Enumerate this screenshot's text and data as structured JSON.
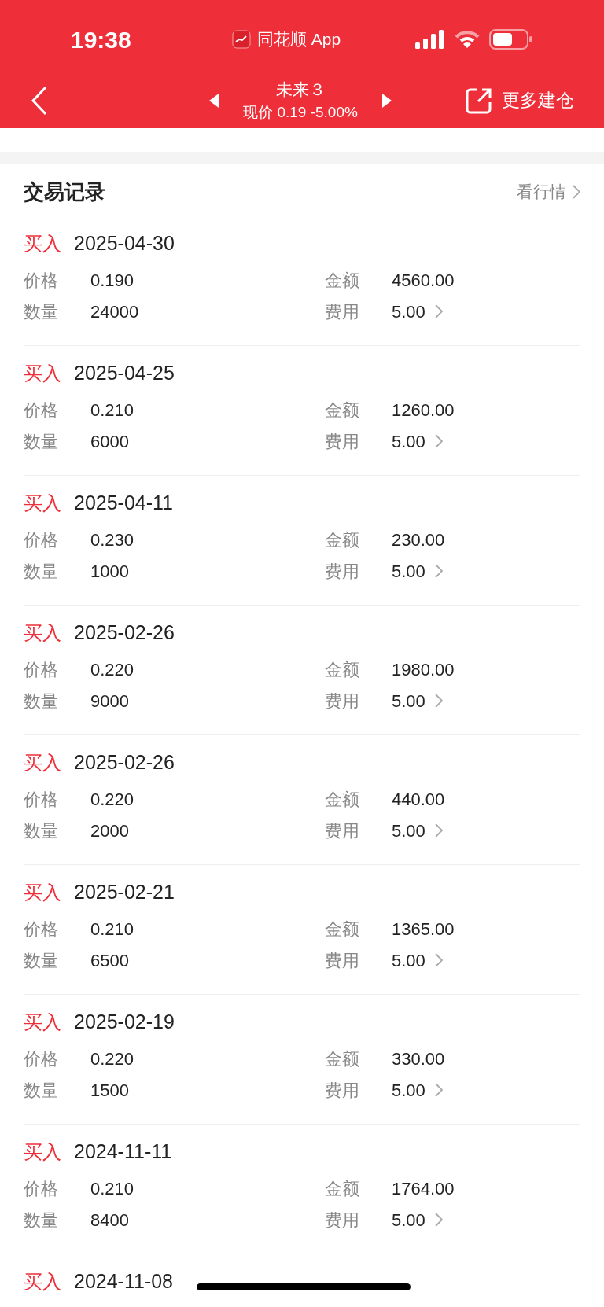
{
  "status_bar": {
    "time": "19:38",
    "app": "同花顺 App"
  },
  "header": {
    "title": "未来３",
    "subtitle": "现价 0.19 -5.00%",
    "action": "更多建仓"
  },
  "section": {
    "title": "交易记录",
    "link": "看行情"
  },
  "records": [
    {
      "type": "买入",
      "date": "2025-04-30",
      "price_label": "价格",
      "price": "0.190",
      "amount_label": "金额",
      "amount": "4560.00",
      "qty_label": "数量",
      "qty": "24000",
      "fee_label": "费用",
      "fee": "5.00"
    },
    {
      "type": "买入",
      "date": "2025-04-25",
      "price_label": "价格",
      "price": "0.210",
      "amount_label": "金额",
      "amount": "1260.00",
      "qty_label": "数量",
      "qty": "6000",
      "fee_label": "费用",
      "fee": "5.00"
    },
    {
      "type": "买入",
      "date": "2025-04-11",
      "price_label": "价格",
      "price": "0.230",
      "amount_label": "金额",
      "amount": "230.00",
      "qty_label": "数量",
      "qty": "1000",
      "fee_label": "费用",
      "fee": "5.00"
    },
    {
      "type": "买入",
      "date": "2025-02-26",
      "price_label": "价格",
      "price": "0.220",
      "amount_label": "金额",
      "amount": "1980.00",
      "qty_label": "数量",
      "qty": "9000",
      "fee_label": "费用",
      "fee": "5.00"
    },
    {
      "type": "买入",
      "date": "2025-02-26",
      "price_label": "价格",
      "price": "0.220",
      "amount_label": "金额",
      "amount": "440.00",
      "qty_label": "数量",
      "qty": "2000",
      "fee_label": "费用",
      "fee": "5.00"
    },
    {
      "type": "买入",
      "date": "2025-02-21",
      "price_label": "价格",
      "price": "0.210",
      "amount_label": "金额",
      "amount": "1365.00",
      "qty_label": "数量",
      "qty": "6500",
      "fee_label": "费用",
      "fee": "5.00"
    },
    {
      "type": "买入",
      "date": "2025-02-19",
      "price_label": "价格",
      "price": "0.220",
      "amount_label": "金额",
      "amount": "330.00",
      "qty_label": "数量",
      "qty": "1500",
      "fee_label": "费用",
      "fee": "5.00"
    },
    {
      "type": "买入",
      "date": "2024-11-11",
      "price_label": "价格",
      "price": "0.210",
      "amount_label": "金额",
      "amount": "1764.00",
      "qty_label": "数量",
      "qty": "8400",
      "fee_label": "费用",
      "fee": "5.00"
    },
    {
      "type": "买入",
      "date": "2024-11-08"
    }
  ]
}
